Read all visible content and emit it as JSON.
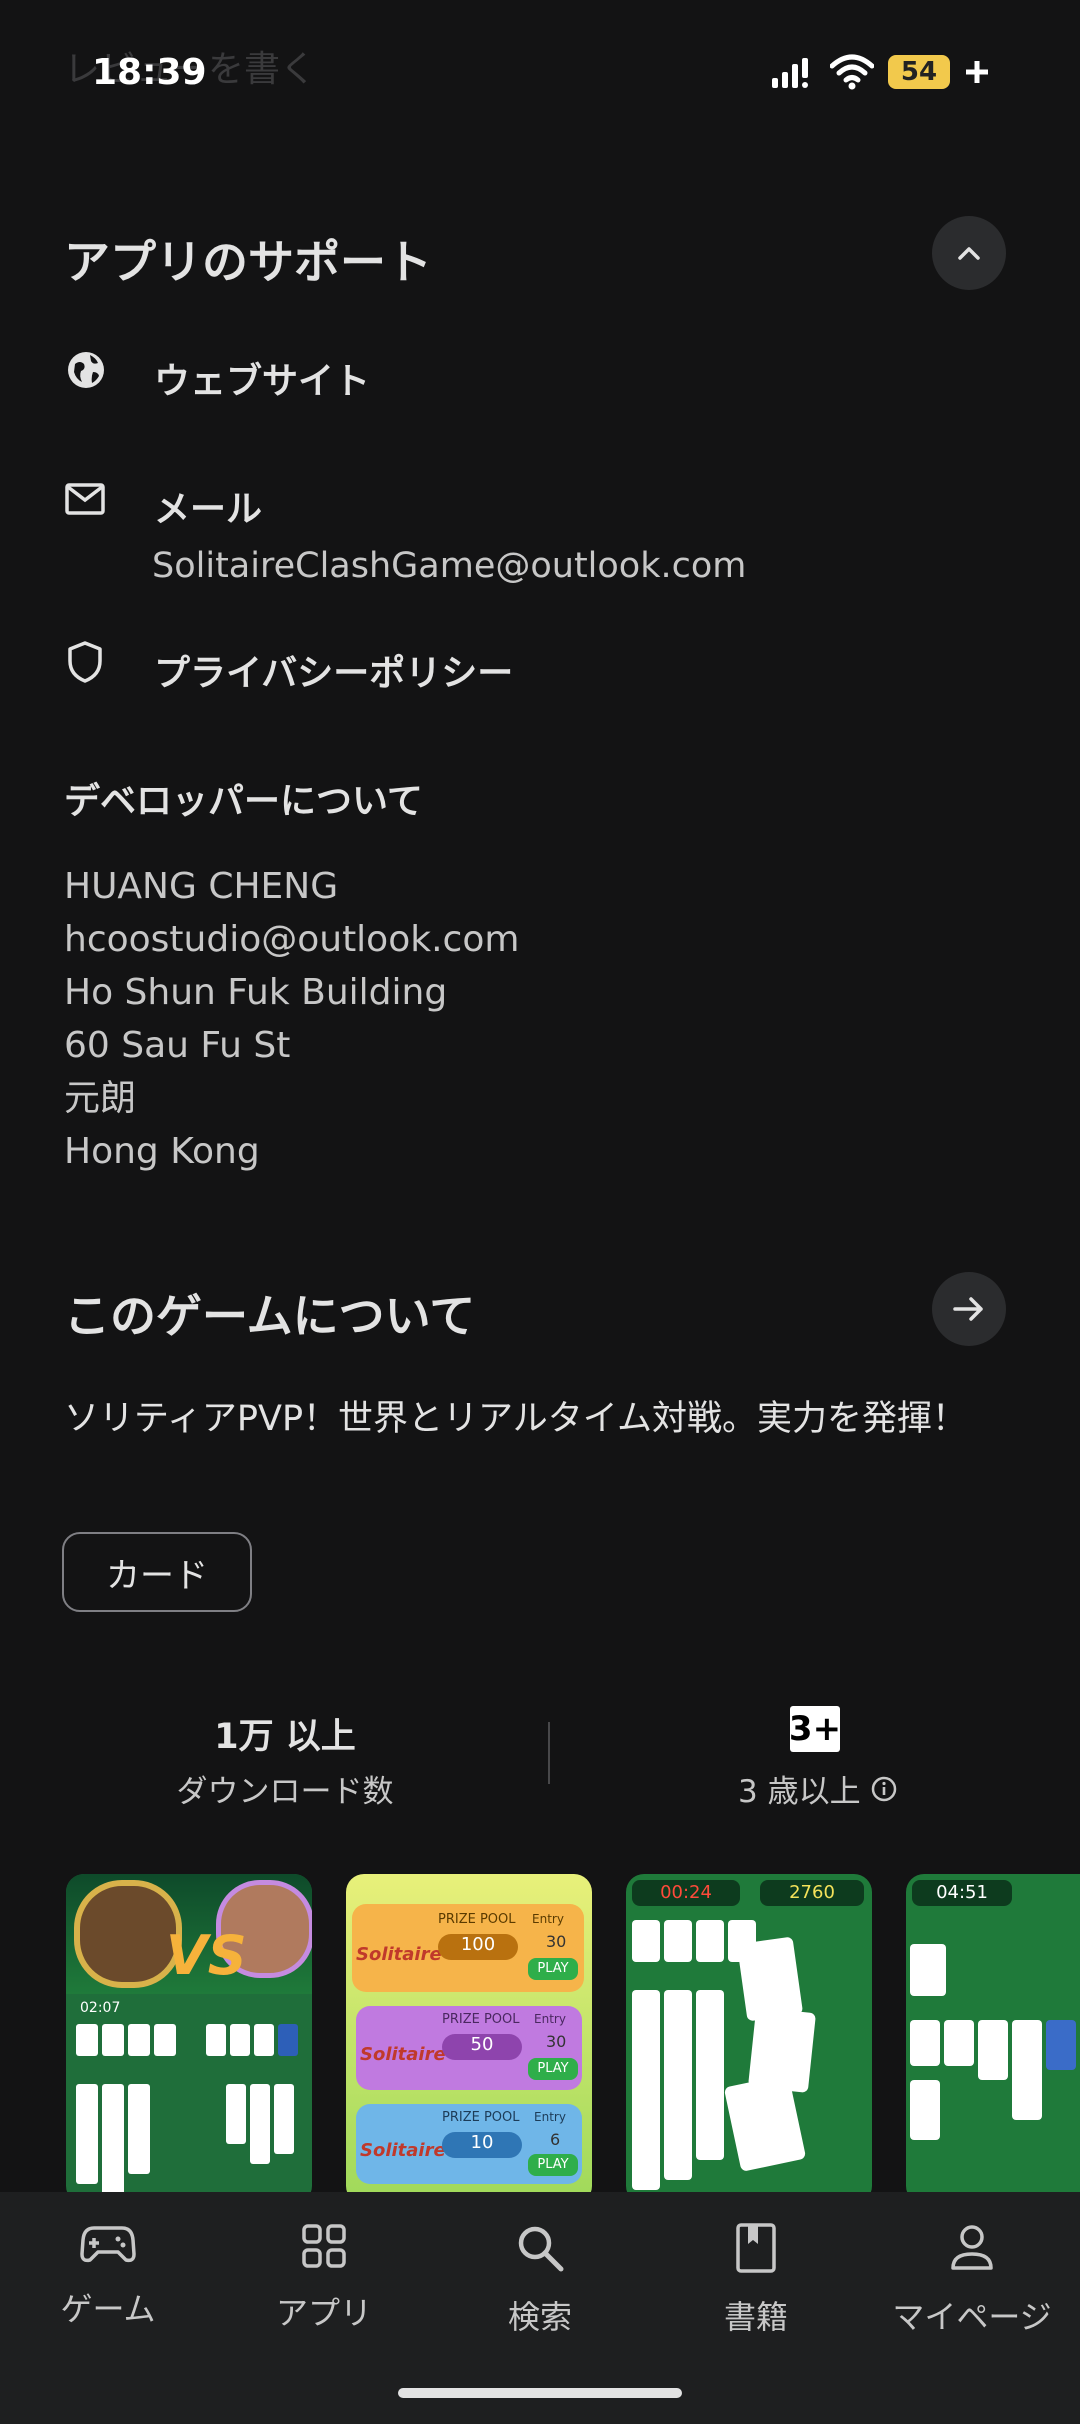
{
  "status_bar": {
    "time": "18:39",
    "faded_text": "レビューを書く",
    "battery": "54"
  },
  "support": {
    "title": "アプリのサポート",
    "website_label": "ウェブサイト",
    "email_label": "メール",
    "email_value": "SolitaireClashGame@outlook.com",
    "privacy_label": "プライバシーポリシー"
  },
  "developer": {
    "title": "デベロッパーについて",
    "lines": [
      "HUANG CHENG",
      "hcoostudio@outlook.com",
      "Ho Shun Fuk Building",
      "60 Sau Fu St",
      "元朗",
      "Hong Kong"
    ]
  },
  "about": {
    "title": "このゲームについて",
    "description": "ソリティアPVP！世界とリアルタイム対戦。実力を発揮！",
    "chip": "カード"
  },
  "stats": {
    "downloads_value": "1万 以上",
    "downloads_label": "ダウンロード数",
    "rating_badge": "3+",
    "rating_label": "3 歳以上"
  },
  "screenshots": {
    "s2_prize_pool": "PRIZE POOL",
    "s2_values": [
      "100",
      "50",
      "10"
    ],
    "s2_entry": "Entry",
    "s2_entries": [
      "30",
      "30",
      "6"
    ],
    "s2_play": "PLAY",
    "s2_logo": "Solitaire",
    "s1_timer": "02:07",
    "s1_vs": "VS",
    "s3_timer": "00:24",
    "s3_score": "2760",
    "s4_timer": "04:51"
  },
  "nav": {
    "items": [
      "ゲーム",
      "アプリ",
      "検索",
      "書籍",
      "マイページ"
    ]
  },
  "colors": {
    "background": "#131314",
    "nav_background": "#1e1f20",
    "battery": "#f2c94c",
    "table_green": "#1f7a3a"
  }
}
